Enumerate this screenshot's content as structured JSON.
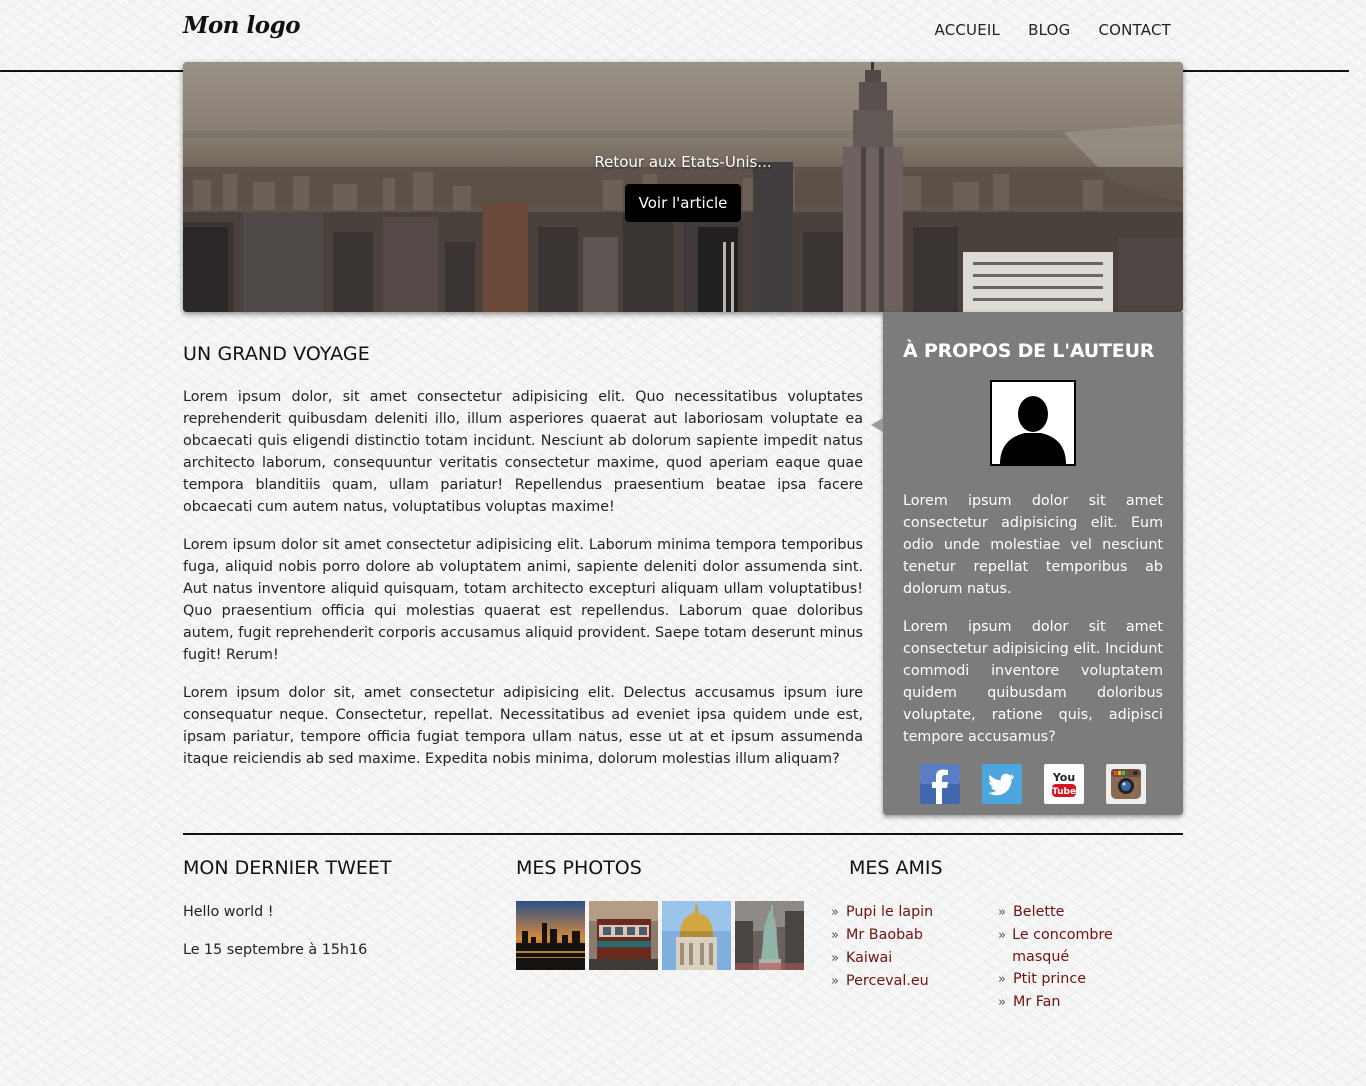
{
  "header": {
    "logo": "Mon logo",
    "nav": [
      "ACCUEIL",
      "BLOG",
      "CONTACT"
    ]
  },
  "banner": {
    "caption": "Retour aux Etats-Unis...",
    "button": "Voir l'article"
  },
  "article": {
    "title": "UN GRAND VOYAGE",
    "paragraphs": [
      "Lorem ipsum dolor, sit amet consectetur adipisicing elit. Quo necessitatibus voluptates reprehenderit quibusdam deleniti illo, illum asperiores quaerat aut laboriosam voluptate ea obcaecati quis eligendi distinctio totam incidunt. Nesciunt ab dolorum sapiente impedit natus architecto laborum, consequuntur veritatis consectetur maxime, quod aperiam eaque quae tempora blanditiis quam, ullam pariatur! Repellendus praesentium beatae ipsa facere obcaecati cum autem natus, voluptatibus voluptas maxime!",
      "Lorem ipsum dolor sit amet consectetur adipisicing elit. Laborum minima tempora temporibus fuga, aliquid nobis porro dolore ab voluptatem animi, sapiente deleniti dolor assumenda sint. Aut natus inventore aliquid quisquam, totam architecto excepturi aliquam ullam voluptatibus! Quo praesentium officia qui molestias quaerat est repellendus. Laborum quae doloribus autem, fugit reprehenderit corporis accusamus aliquid provident. Saepe totam deserunt minus fugit! Rerum!",
      "Lorem ipsum dolor sit, amet consectetur adipisicing elit. Delectus accusamus ipsum iure consequatur neque. Consectetur, repellat. Necessitatibus ad eveniet ipsa quidem unde est, ipsam pariatur, tempore officia fugiat tempora ullam natus, esse ut at et ipsum assumenda itaque reiciendis ab sed maxime. Expedita nobis minima, dolorum molestias illum aliquam?"
    ]
  },
  "sidebar": {
    "title": "À PROPOS DE L'AUTEUR",
    "paragraphs": [
      "Lorem ipsum dolor sit amet consectetur adipisicing elit. Eum odio unde molestiae vel nesciunt tenetur repellat temporibus ab dolorum natus.",
      "Lorem ipsum dolor sit amet consectetur adipisicing elit. Incidunt commodi inventore voluptatem quidem quibusdam doloribus voluptate, ratione quis, adipisci tempore accusamus?"
    ],
    "socials": [
      {
        "icon": "facebook-icon",
        "color": "#3b5998"
      },
      {
        "icon": "twitter-icon",
        "color": "#55acee"
      },
      {
        "icon": "youtube-icon",
        "color": "#cc181e"
      },
      {
        "icon": "instagram-icon",
        "color": "#8a6a4f"
      }
    ]
  },
  "footer": {
    "tweet": {
      "title": "MON DERNIER TWEET",
      "text": "Hello world !",
      "date": "Le 15 septembre à 15h16"
    },
    "photos": {
      "title": "MES PHOTOS"
    },
    "friends": {
      "title": "MES AMIS",
      "col1": [
        "Pupi le lapin",
        "Mr Baobab",
        "Kaiwai",
        "Perceval.eu"
      ],
      "col2": [
        "Belette",
        "Le concombre masqué",
        "Ptit prince",
        "Mr Fan"
      ],
      "bullet": "»"
    }
  }
}
